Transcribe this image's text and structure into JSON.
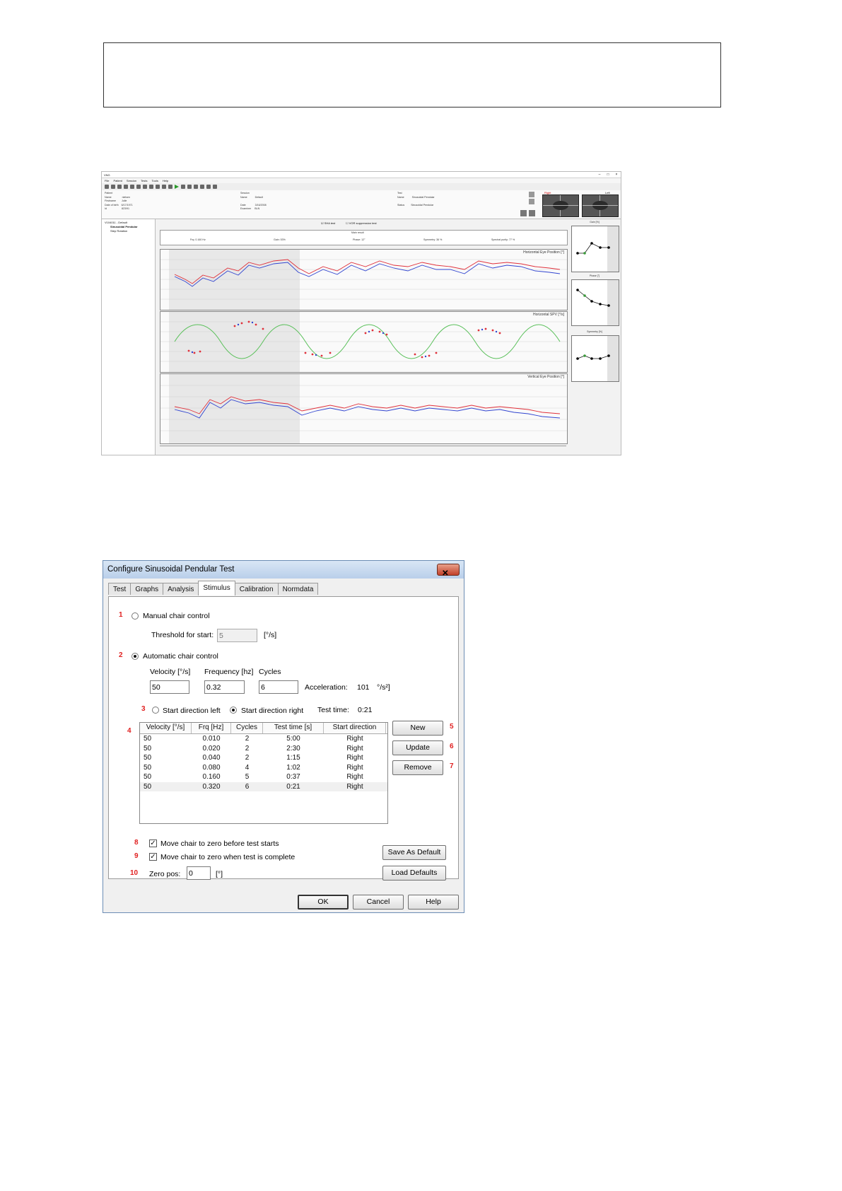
{
  "vng": {
    "window_title": "VNG",
    "menu": [
      "File",
      "Patient",
      "Session",
      "Tests",
      "Tools",
      "Help"
    ],
    "patient": {
      "heading": "Patient",
      "fields": [
        "Name",
        "Firstname",
        "Date of birth",
        "Id"
      ],
      "values": [
        "nielsen",
        "Julie",
        "6/17/1971",
        "823/91"
      ]
    },
    "session": {
      "heading": "Session",
      "fields": [
        "Name",
        "Date",
        "Examiner"
      ],
      "values": [
        "Default",
        "3/16/2008",
        "BLN"
      ]
    },
    "test": {
      "heading": "Test",
      "fields": [
        "Name",
        "Status"
      ],
      "values": [
        "Sinusoidal Pendular",
        "Sinusoidal Pendular"
      ]
    },
    "camera_labels": [
      "Right",
      "Left"
    ],
    "tree": [
      "V104011 - Default",
      "Sinusoidal Pendular",
      "Step Rotation"
    ],
    "options": [
      "SHA test",
      "VOR suppression test"
    ],
    "summary_header": "Main result",
    "summary": [
      "Frq: 0.160 Hz",
      "Gain: 53%",
      "Phase: 12°",
      "Symmetry: 36 %",
      "Spectral purity: 77 %"
    ],
    "panel_titles": [
      "Horizontal Eye Position [°]",
      "Horizontal SPV [°/s]",
      "Vertical Eye Position [°]"
    ],
    "right_titles": [
      "Gain [%]",
      "Phase [°]",
      "Symmetry [%]"
    ]
  },
  "dialog": {
    "title": "Configure Sinusoidal Pendular Test",
    "close_glyph": "✕",
    "tabs": [
      "Test",
      "Graphs",
      "Analysis",
      "Stimulus",
      "Calibration",
      "Normdata"
    ],
    "active_tab": "Stimulus",
    "manual": {
      "label": "Manual chair control",
      "threshold_label": "Threshold for start:",
      "threshold_value": "5",
      "threshold_unit": "[°/s]"
    },
    "automatic": {
      "label": "Automatic chair control"
    },
    "velocity": {
      "label": "Velocity [°/s]",
      "value": "50"
    },
    "frequency": {
      "label": "Frequency [hz]",
      "value": "0.32"
    },
    "cycles": {
      "label": "Cycles",
      "value": "6"
    },
    "acceleration": {
      "label": "Acceleration:",
      "value": "101",
      "unit": "°/s²]"
    },
    "direction": {
      "left": "Start direction left",
      "right": "Start direction right",
      "test_time_label": "Test time:",
      "test_time_value": "0:21"
    },
    "table": {
      "columns": [
        "Velocity [°/s]",
        "Frq [Hz]",
        "Cycles",
        "Test time [s]",
        "Start direction"
      ],
      "rows": [
        [
          "50",
          "0.010",
          "2",
          "5:00",
          "Right"
        ],
        [
          "50",
          "0.020",
          "2",
          "2:30",
          "Right"
        ],
        [
          "50",
          "0.040",
          "2",
          "1:15",
          "Right"
        ],
        [
          "50",
          "0.080",
          "4",
          "1:02",
          "Right"
        ],
        [
          "50",
          "0.160",
          "5",
          "0:37",
          "Right"
        ],
        [
          "50",
          "0.320",
          "6",
          "0:21",
          "Right"
        ]
      ]
    },
    "buttons": {
      "new": "New",
      "update": "Update",
      "remove": "Remove",
      "save_default": "Save As Default",
      "load_defaults": "Load Defaults",
      "ok": "OK",
      "cancel": "Cancel",
      "help": "Help"
    },
    "move_before": "Move chair to zero before test starts",
    "move_after": "Move chair to zero when test is complete",
    "zero_pos": {
      "label": "Zero pos:",
      "value": "0",
      "unit": "[°]"
    },
    "callouts": [
      "1",
      "2",
      "3",
      "4",
      "5",
      "6",
      "7",
      "8",
      "9",
      "10"
    ]
  }
}
